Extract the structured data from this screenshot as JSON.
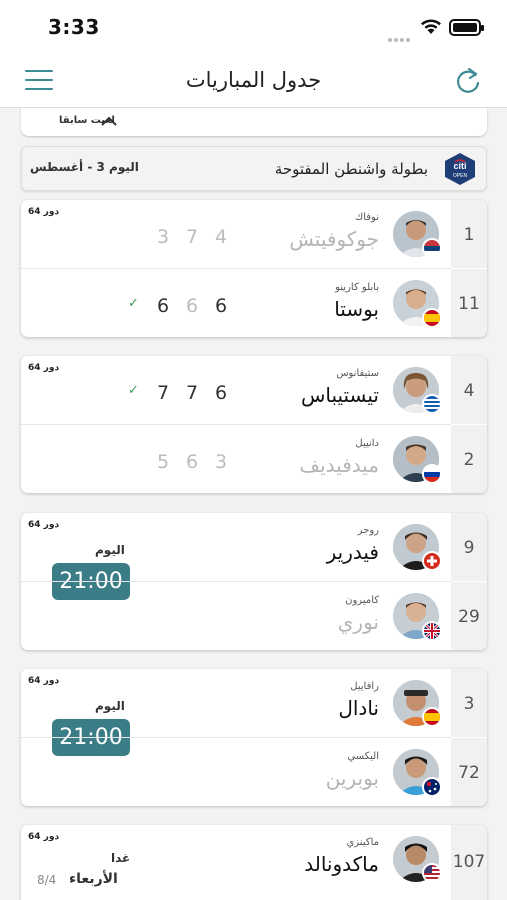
{
  "status_bar": {
    "time": "3:33"
  },
  "nav": {
    "title": "جدول المباريات"
  },
  "previous": {
    "label": "لعبت سابقا"
  },
  "tournament": {
    "name": "بطولة واشنطن المفتوحة",
    "date": "اليوم   3 - أغسطس",
    "logo_text_top": "citi",
    "logo_text_bottom": "OPEN"
  },
  "matches": [
    {
      "round": "دور 64",
      "players": [
        {
          "seed": "1",
          "first": "نوفاك",
          "last": "جوكوفيتش",
          "flag": "serbia",
          "scores": [
            "3",
            "7",
            "4"
          ],
          "winner": false
        },
        {
          "seed": "11",
          "first": "بابلو كارينو",
          "last": "بوستا",
          "flag": "spain",
          "scores": [
            "6",
            "6",
            "6"
          ],
          "winner": true
        }
      ]
    },
    {
      "round": "دور 64",
      "players": [
        {
          "seed": "4",
          "first": "ستيفانوس",
          "last": "تيستيباس",
          "flag": "greece",
          "scores": [
            "7",
            "7",
            "6"
          ],
          "winner": true
        },
        {
          "seed": "2",
          "first": "دانييل",
          "last": "ميدفيديف",
          "flag": "russia",
          "scores": [
            "5",
            "6",
            "3"
          ],
          "winner": false
        }
      ]
    },
    {
      "round": "دور 64",
      "when": "اليوم",
      "time": "21:00",
      "players": [
        {
          "seed": "9",
          "first": "روجر",
          "last": "فيدرير",
          "flag": "switzerland"
        },
        {
          "seed": "29",
          "first": "كاميرون",
          "last": "نوري",
          "flag": "uk"
        }
      ]
    },
    {
      "round": "دور 64",
      "when": "اليوم",
      "time": "21:00",
      "players": [
        {
          "seed": "3",
          "first": "رافاييل",
          "last": "نادال",
          "flag": "spain"
        },
        {
          "seed": "72",
          "first": "اليكسي",
          "last": "بوبرين",
          "flag": "australia"
        }
      ]
    },
    {
      "round": "دور 64",
      "when": "غدا",
      "day": "الأربعاء",
      "date": "8/4",
      "players": [
        {
          "seed": "107",
          "first": "ماكينزي",
          "last": "ماكدونالد",
          "flag": "usa"
        }
      ]
    }
  ]
}
